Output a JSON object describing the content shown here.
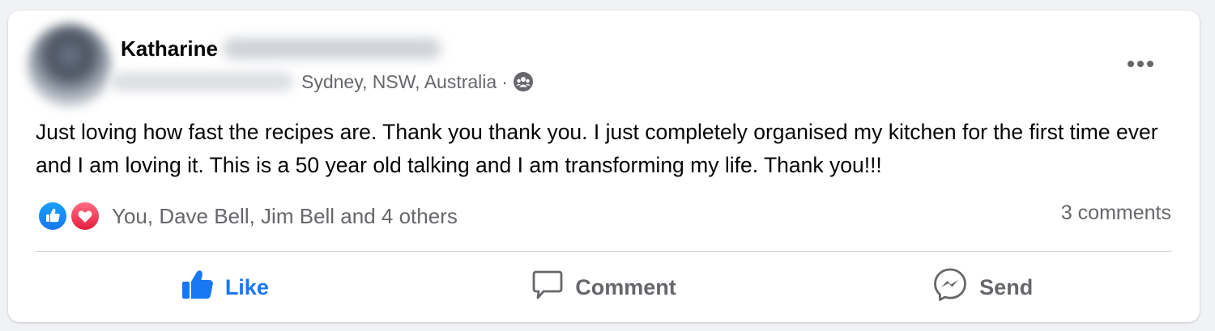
{
  "post": {
    "author_first_name": "Katharine",
    "location": "Sydney, NSW, Australia",
    "separator": "·",
    "audience_icon": "group-icon",
    "more_icon": "more-horizontal-icon",
    "body": "Just loving how fast the recipes are. Thank you thank you. I just completely organised my kitchen for the first time ever and I am loving it. This is a 50 year old talking and I am transforming my life. Thank you!!!",
    "reactions": {
      "icons": [
        "like-reaction-icon",
        "love-reaction-icon"
      ],
      "summary": "You, Dave Bell, Jim Bell and 4 others"
    },
    "comments_count": "3 comments"
  },
  "actions": {
    "like_label": "Like",
    "comment_label": "Comment",
    "send_label": "Send"
  },
  "colors": {
    "accent": "#1877f2",
    "secondary_text": "#65676b",
    "love": "#e41e3f",
    "background": "#f0f2f5"
  }
}
